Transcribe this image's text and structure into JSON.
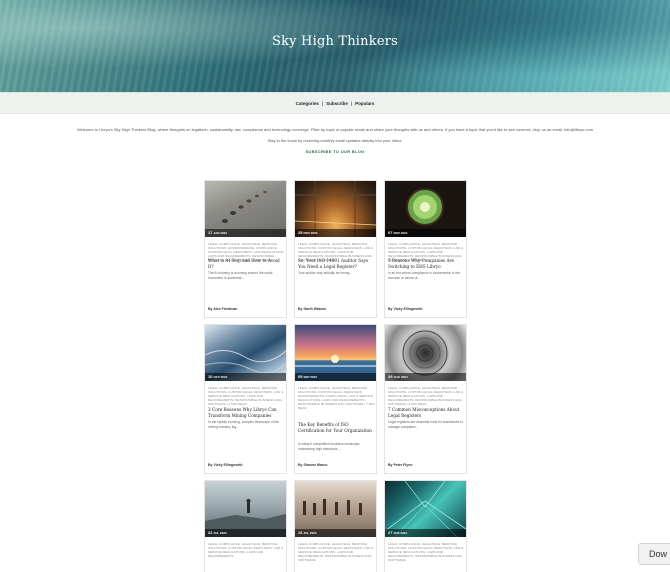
{
  "hero": {
    "title": "Sky High Thinkers"
  },
  "nav": {
    "categories": "Categories",
    "sep1": "|",
    "subscribe": "Subscribe",
    "sep2": "|",
    "popular": "Populars"
  },
  "intro": {
    "welcome": "Welcome to Libryo's Sky High Thinkers Blog, where thoughts on legaltech, sustainability, law, compliance and technology converge. Filter by topic or popular reads and share your thoughts with us and others. If you have a topic that you'd like to see covered, drop us an email: info@libryo.com",
    "stay": "Stay in the know by receiving monthly email updates directly into your inbox.",
    "subscribe_label": "SUBSCRIBE TO OUR BLOG"
  },
  "cards": [
    {
      "day": "17",
      "month": "JAN 2024",
      "tags": "LEGAL COMPLIANCE, LEGALTECH, BESPOKE SOLUTIONS, ENVIRONMENTAL COMPLIANCE, CUSTOM LEGAL REGISTERS, LAW REGULATIONS, LAWS AND REQUIREMENTS, RESPONSIBLE BUSINESS ESG SOFTWARE | 6 MIN READ",
      "title": "What is AI Slop and How to Avoid It?",
      "excerpt": "The AI industry is booming around the world. Innovation is accelerati...",
      "author": "By Alex Friedman"
    },
    {
      "day": "25",
      "month": "NOV 2024",
      "tags": "LEGAL COMPLIANCE, LEGALTECH, BESPOKE SOLUTIONS, CUSTOM LEGAL REGISTERS, LAW & SERVICE REGULATIONS, LAWS AND REQUIREMENTS, RESPONSIBLE BUSINESS ESG SOFTWARE | 5 MIN READ",
      "title": "So, Your ISO 14001 Auditor Says You Need a Legal Register?",
      "excerpt": "Your auditor may actually be wrong...",
      "author": "By Garth Watson"
    },
    {
      "day": "07",
      "month": "NOV 2024",
      "tags": "LEGAL COMPLIANCE, LEGALTECH, BESPOKE SOLUTIONS, CUSTOM LEGAL REGISTERS, LAW & SERVICE REGULATIONS, LAWS AND REQUIREMENTS, RESPONSIBLE BUSINESS ESG SOFTWARE | 4 MIN READ",
      "title": "5 Reasons Why Companies Are Switching to EHS Libryo",
      "excerpt": "In an era where compliance is fundamental to the success or failure of...",
      "author": "By Vicky Ellingworth"
    },
    {
      "day": "10",
      "month": "OCT 2024",
      "tags": "LEGAL COMPLIANCE, LEGALTECH, BESPOKE SOLUTIONS, CUSTOM LEGAL REGISTERS, LAW & SERVICE REGULATIONS, LAWS AND REQUIREMENTS, RESPONSIBLE BUSINESS ESG SOFTWARE | 4 MIN READ",
      "title": "3 Core Reasons Why Libryo Can Transform Mining Companies",
      "excerpt": "In the rapidly evolving, complex landscape of the mining industry, leg...",
      "author": "By Vicky Ellingworth"
    },
    {
      "day": "05",
      "month": "SEP 2024",
      "tags": "LEGAL COMPLIANCE, LEGALTECH, BESPOKE SOLUTIONS, CUSTOM LEGAL REGISTERS, ENVIRONMENTAL COMPLIANCE, LAW & SERVICE REGULATIONS, LAWS AND REQUIREMENTS, RESPONSIBLE BUSINESS ESG SOFTWARE | 7 MIN READ",
      "title": "The Key Benefits of ISO Certification for Your Organization",
      "excerpt": "In today's competitive business landscape, maintaining high standards ...",
      "author": "By Simone Marco"
    },
    {
      "day": "29",
      "month": "AUG 2024",
      "tags": "LEGAL COMPLIANCE, LEGALTECH, BESPOKE SOLUTIONS, CUSTOM LEGAL REGISTERS, LAW & SERVICE REGULATIONS, LAWS AND REQUIREMENTS, RESPONSIBLE BUSINESS ESG SOFTWARE | 4 MIN READ",
      "title": "7 Common Misconceptions About Legal Registers",
      "excerpt": "Legal registers are essential tools for businesses to manage complianc...",
      "author": "By Peter Flynn"
    },
    {
      "day": "22",
      "month": "JUL 2024",
      "tags": "LEGAL COMPLIANCE, LEGALTECH, BESPOKE SOLUTIONS, CUSTOM LEGAL REGISTERS, LAW & SERVICE REGULATIONS, LAWS AND REQUIREMENTS",
      "title": "",
      "excerpt": "",
      "author": ""
    },
    {
      "day": "16",
      "month": "JUL 2024",
      "tags": "LEGAL COMPLIANCE, LEGALTECH, BESPOKE SOLUTIONS, CUSTOM LEGAL REGISTERS, LAW & SERVICE REGULATIONS, LAWS AND REQUIREMENTS, RESPONSIBLE BUSINESS ESG SOFTWARE",
      "title": "",
      "excerpt": "",
      "author": ""
    },
    {
      "day": "27",
      "month": "JUN 2024",
      "tags": "LEGAL COMPLIANCE, LEGALTECH, BESPOKE SOLUTIONS, CUSTOM LEGAL REGISTERS, LAW & SERVICE REGULATIONS, LAWS AND REQUIREMENTS, RESPONSIBLE BUSINESS ESG SOFTWARE",
      "title": "",
      "excerpt": "",
      "author": ""
    }
  ],
  "floating_button": {
    "label": "Dow"
  }
}
